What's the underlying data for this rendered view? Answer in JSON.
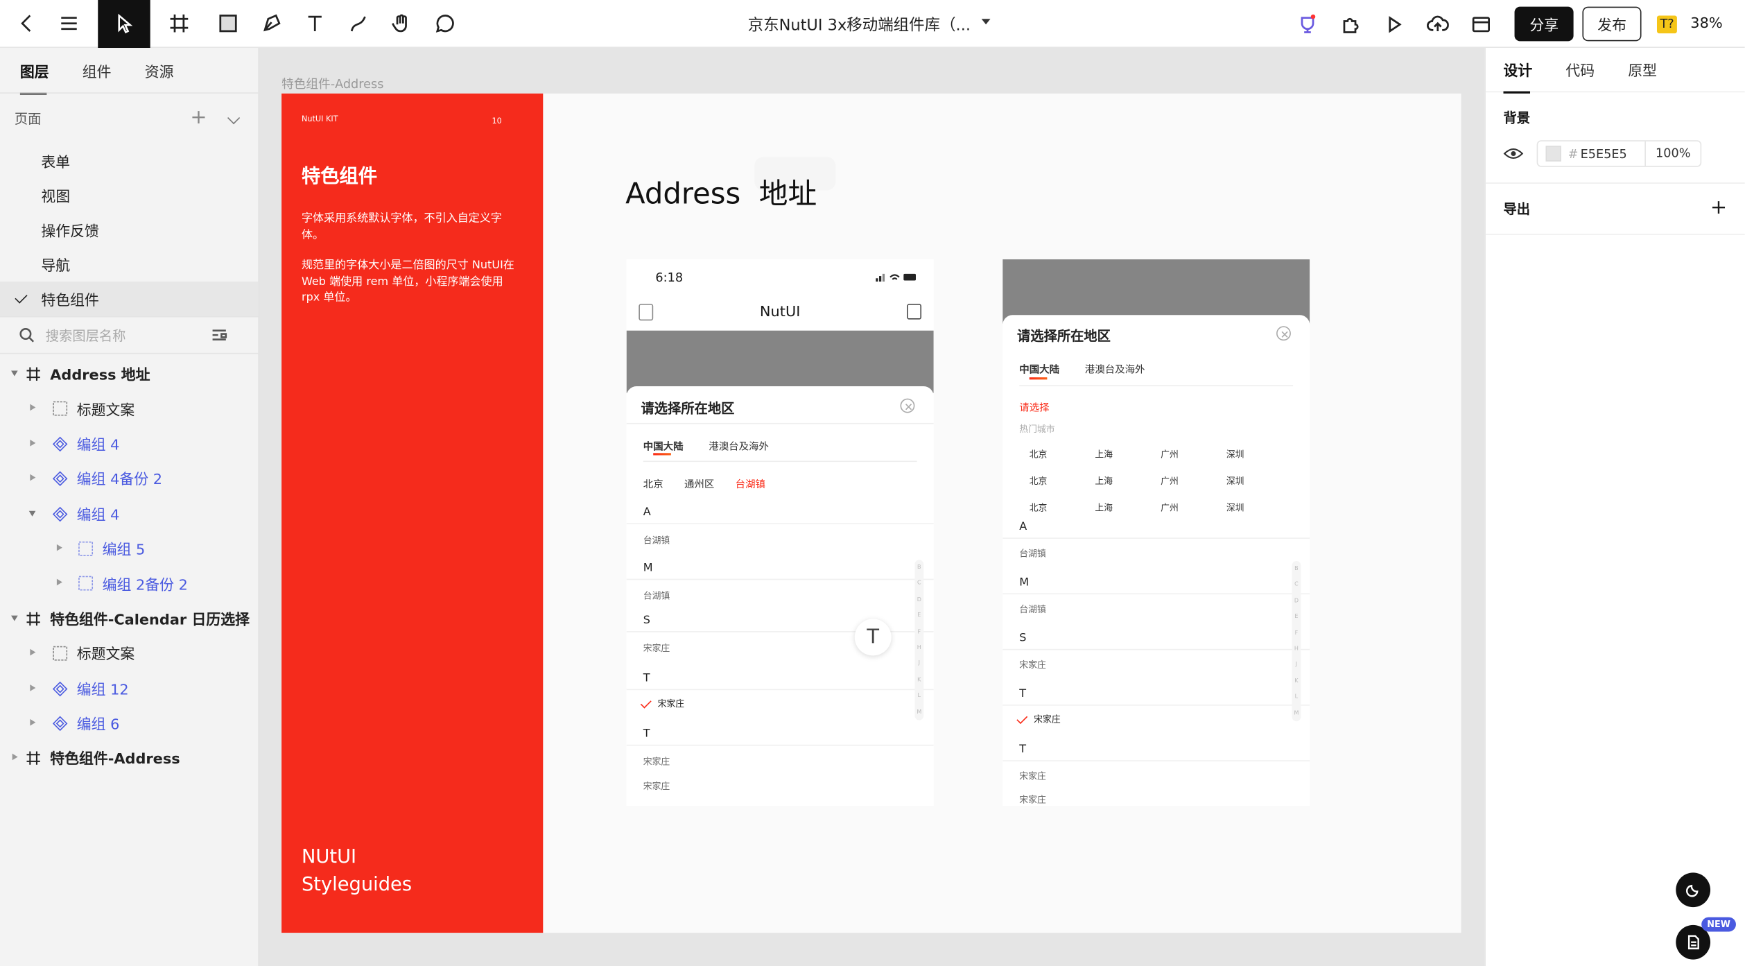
{
  "topbar": {
    "title": "京东NutUI 3x移动端组件库（...",
    "share": "分享",
    "publish": "发布",
    "badge": "T?",
    "zoom": "38%"
  },
  "left": {
    "tabs": [
      "图层",
      "组件",
      "资源"
    ],
    "pages_label": "页面",
    "pages": [
      "表单",
      "视图",
      "操作反馈",
      "导航",
      "特色组件"
    ],
    "search_placeholder": "搜索图层名称",
    "layers": [
      {
        "label": "Address 地址"
      },
      {
        "label": "标题文案"
      },
      {
        "label": "编组 4"
      },
      {
        "label": "编组 4备份 2"
      },
      {
        "label": "编组 4"
      },
      {
        "label": "编组 5"
      },
      {
        "label": "编组 2备份 2"
      },
      {
        "label": "特色组件-Calendar 日历选择"
      },
      {
        "label": "标题文案"
      },
      {
        "label": "编组 12"
      },
      {
        "label": "编组 6"
      },
      {
        "label": "特色组件-Address"
      }
    ]
  },
  "canvas": {
    "frame_label": "特色组件-Address",
    "panel": {
      "kit": "NutUI KIT",
      "num": "10",
      "heading": "特色组件",
      "p1": "字体采用系统默认字体，不引入自定义字体。",
      "p2": "规范里的字体大小是二倍图的尺寸 NutUI在Web 端使用 rem 单位，小程序端会使用 rpx 单位。",
      "footer1": "NUtUI",
      "footer2": "Styleguides"
    },
    "title": "Address  地址",
    "phone1": {
      "time": "6:18",
      "nav_title": "NutUI",
      "sheet_title": "请选择所在地区",
      "tabs": [
        "中国大陆",
        "港澳台及海外"
      ],
      "crumbs": [
        "北京",
        "通州区",
        "台湖镇"
      ],
      "rows": [
        "A",
        "台湖镇",
        "M",
        "台湖镇",
        "S",
        "宋家庄",
        "T",
        "宋家庄",
        "T",
        "宋家庄",
        "宋家庄"
      ],
      "index": [
        "B",
        "C",
        "D",
        "E",
        "F",
        "H",
        "J",
        "K",
        "L",
        "M"
      ],
      "float": "T"
    },
    "phone2": {
      "sheet_title": "请选择所在地区",
      "tabs": [
        "中国大陆",
        "港澳台及海外"
      ],
      "select": "请选择",
      "hot": "热门城市",
      "cities": [
        "北京",
        "上海",
        "广州",
        "深圳",
        "北京",
        "上海",
        "广州",
        "深圳",
        "北京",
        "上海",
        "广州",
        "深圳"
      ],
      "rows": [
        "A",
        "台湖镇",
        "M",
        "台湖镇",
        "S",
        "宋家庄",
        "T",
        "宋家庄",
        "T",
        "宋家庄",
        "宋家庄"
      ],
      "index": [
        "B",
        "C",
        "D",
        "E",
        "F",
        "H",
        "J",
        "K",
        "L",
        "M"
      ]
    }
  },
  "right": {
    "tabs": [
      "设计",
      "代码",
      "原型"
    ],
    "bg_label": "背景",
    "bg_hex": "E5E5E5",
    "bg_opacity": "100%",
    "export_label": "导出",
    "new_badge": "NEW"
  },
  "colors": {
    "brand_red": "#F52B1C",
    "accent_blue": "#4A5AE0",
    "canvas_bg": "#E5E5E5"
  }
}
